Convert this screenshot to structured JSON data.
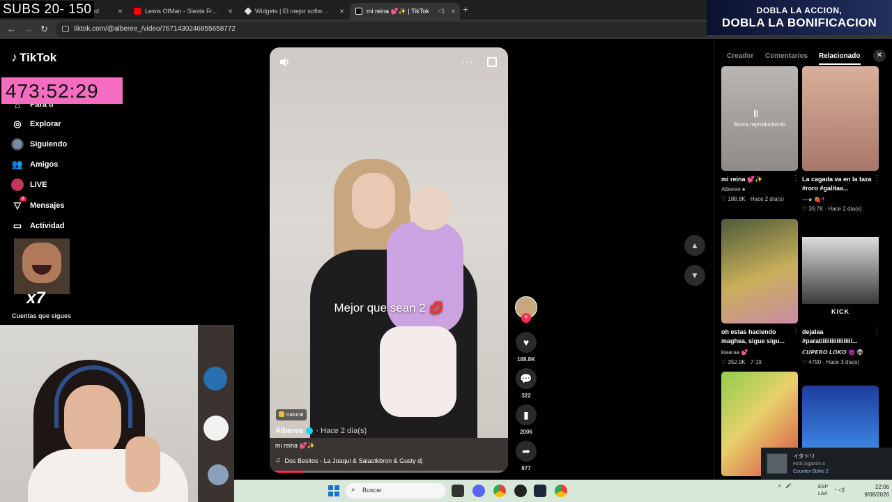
{
  "overlay": {
    "subs": "SUBS 20- 150",
    "timer": "473:52:29",
    "emote_label": "x7"
  },
  "ad": {
    "line1": "DOBLA LA ACCION,",
    "line2": "DOBLA LA BONIFICACION"
  },
  "browser": {
    "tabs": [
      {
        "label": "oard",
        "icon": "generic-icon",
        "color": "#555"
      },
      {
        "label": "Lewis OfMan - Siesta Freestyle",
        "icon": "youtube-icon",
        "color": "#ff0000"
      },
      {
        "label": "Widgets | El mejor software pa",
        "icon": "widget-icon",
        "color": "#ddd"
      },
      {
        "label": "mi reina 💕✨ | TikTok",
        "icon": "tiktok-icon",
        "color": "#ffffff"
      }
    ],
    "url": "tiktok.com/@alberee_/video/7671430246855658772"
  },
  "sidebar": {
    "logo": "TikTok",
    "items": [
      {
        "label": "Para ti",
        "icon": "home-icon"
      },
      {
        "label": "Explorar",
        "icon": "compass-icon"
      },
      {
        "label": "Siguiendo",
        "icon": "following-avatar"
      },
      {
        "label": "Amigos",
        "icon": "friends-icon"
      },
      {
        "label": "LIVE",
        "icon": "live-icon"
      },
      {
        "label": "Mensajes",
        "icon": "messages-icon",
        "badge": "7"
      },
      {
        "label": "Actividad",
        "icon": "activity-icon"
      }
    ],
    "following_label": "Cuentas que sigues"
  },
  "video": {
    "caption": "Mejor que sean 2 💋",
    "tag": "natural",
    "author": "Alberee",
    "time": "· Hace 2 día(s)",
    "title": "mi reina 💕✨",
    "music": "Dos Besitos - La Joaqui & Salastkbron & Gusty dj",
    "progress": 0.14
  },
  "actions": {
    "likes": "188.8K",
    "comments": "322",
    "saves": "2006",
    "shares": "677"
  },
  "panel": {
    "tabs": [
      "Creador",
      "Comentarios",
      "Relacionado"
    ],
    "active_tab": "Relacionado",
    "now_playing": "Ahora reproduciendo",
    "cards": [
      {
        "title": "mi reina 💕✨",
        "author": "Alberee ●",
        "meta": "♡ 188.8K · Hace 2 día(s)",
        "thumb_colors": [
          "#b9b6b3",
          "#8f8a86"
        ]
      },
      {
        "title": "La cagada va en la taza #roro #galitaa...",
        "author": "—★ 🍓!!",
        "meta": "♡ 39.7K · Hace 2 día(s)",
        "thumb_colors": [
          "#d9b09b",
          "#a7786a"
        ]
      },
      {
        "title": "oh estas haciendo maghea, sigue sigu...",
        "author": "kiaaraa 💕",
        "meta": "♡ 352.9K · 7-19",
        "thumb_colors": [
          "#4d5a3a",
          "#c98aa8"
        ]
      },
      {
        "title": "dejalaa #paratiiiiiiiiiiiiiiiiii...",
        "author": "𝘾𝙐𝙋𝙀𝙍𝙊 𝙇𝙊𝙆𝙊 😈 👽",
        "meta": "♡ 4790 · Hace 3 día(s)",
        "thumb_colors": [
          "#dcdcdc",
          "#3a3a3a"
        ],
        "overlay": "KICK"
      },
      {
        "title": "",
        "author": "",
        "meta": "",
        "thumb_colors": [
          "#8fcf4a",
          "#d64848"
        ]
      },
      {
        "title": "",
        "author": "",
        "meta": "",
        "thumb_colors": [
          "#1d3d9e",
          "#4aa3ff"
        ]
      }
    ]
  },
  "steam": {
    "name": "イタドリ",
    "status": "está jugando a",
    "game": "Counter-Strike 2"
  },
  "taskbar": {
    "search_placeholder": "Buscar",
    "lang1": "ESP",
    "lang2": "LAA",
    "time": "22:06",
    "date": "9/08/2026"
  }
}
